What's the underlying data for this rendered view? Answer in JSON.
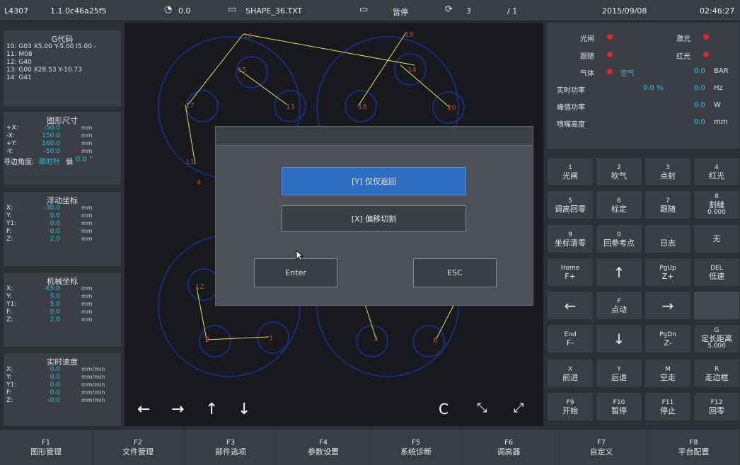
{
  "status": {
    "id": "L4307",
    "version": "1.1.0c46a25f5",
    "speed": "0.0",
    "file": "SHAPE_36.TXT",
    "state": "暂停",
    "count": "3",
    "page": "/ 1",
    "date": "2015/09/08",
    "time": "02:46:27"
  },
  "gcode": {
    "title": "G代码",
    "lines": [
      "10: G03 X5.00 Y-5.00 I5.00 -",
      "11: M08",
      "12: G40",
      "13: G00 X28.53 Y-10.73",
      "14: G41"
    ]
  },
  "size": {
    "title": "图形尺寸",
    "rows": [
      {
        "k": "+X:",
        "v": "-50.0",
        "u": "mm"
      },
      {
        "k": "-X:",
        "v": "150.0",
        "u": "mm"
      },
      {
        "k": "+Y:",
        "v": "160.0",
        "u": "mm"
      },
      {
        "k": "-Y:",
        "v": "-50.0",
        "u": "mm"
      }
    ],
    "edge_label": "寻边角度:",
    "edge_dir": "顺时针",
    "edge_off": "偏",
    "edge_val": "0.0 °"
  },
  "float": {
    "title": "浮动坐标",
    "rows": [
      {
        "k": "X:",
        "v": "-30.0",
        "u": "mm"
      },
      {
        "k": "Y:",
        "v": "0.0",
        "u": "mm"
      },
      {
        "k": "Y1:",
        "v": "0.0",
        "u": "mm"
      },
      {
        "k": "F:",
        "v": "0.0",
        "u": "mm"
      },
      {
        "k": "Z:",
        "v": "2.0",
        "u": "mm"
      }
    ]
  },
  "mech": {
    "title": "机械坐标",
    "rows": [
      {
        "k": "X:",
        "v": "-65.0",
        "u": "mm"
      },
      {
        "k": "Y:",
        "v": "5.0",
        "u": "mm"
      },
      {
        "k": "Y1:",
        "v": "5.0",
        "u": "mm"
      },
      {
        "k": "F:",
        "v": "0.0",
        "u": "mm"
      },
      {
        "k": "Z:",
        "v": "2.0",
        "u": "mm"
      }
    ]
  },
  "speedp": {
    "title": "实时速度",
    "rows": [
      {
        "k": "X:",
        "v": "0.0",
        "u": "mm/min"
      },
      {
        "k": "Y:",
        "v": "0.0",
        "u": "mm/min"
      },
      {
        "k": "Y1:",
        "v": "0.0",
        "u": "mm/min"
      },
      {
        "k": "F:",
        "v": "0.0",
        "u": "mm/min"
      },
      {
        "k": "Z:",
        "v": "-0.0",
        "u": "mm/min"
      }
    ]
  },
  "right": {
    "shutter": "光闸",
    "laser": "激光",
    "follow": "跟随",
    "red": "红光",
    "gas": "气体",
    "air": "空气",
    "gas_val": "0.0",
    "gas_unit": "BAR",
    "power": "实时功率",
    "power_val": "0.0 %",
    "power_hz": "0.0",
    "hz": "Hz",
    "peak": "峰值功率",
    "peak_val": "0.0",
    "w": "W",
    "nozzle": "喷嘴高度",
    "nozzle_val": "0.0",
    "mm": "mm"
  },
  "keys": [
    {
      "n": "1",
      "l": "光闸"
    },
    {
      "n": "2",
      "l": "吹气"
    },
    {
      "n": "3",
      "l": "点射"
    },
    {
      "n": "4",
      "l": "红光"
    },
    {
      "n": "5",
      "l": "调高回零"
    },
    {
      "n": "6",
      "l": "标定"
    },
    {
      "n": "7",
      "l": "跟随"
    },
    {
      "n": "8",
      "l": "割缝",
      "s": "0.000"
    },
    {
      "n": "9",
      "l": "坐标清零"
    },
    {
      "n": "0",
      "l": "回参考点"
    },
    {
      "n": ".",
      "l": "日志"
    },
    {
      "n": "",
      "l": "无"
    },
    {
      "n": "Home",
      "l": "F+"
    },
    {
      "n": "",
      "l": "↑",
      "a": true
    },
    {
      "n": "PgUp",
      "l": "Z+"
    },
    {
      "n": "DEL",
      "l": "低速"
    },
    {
      "n": "",
      "l": "←",
      "a": true
    },
    {
      "n": "F",
      "l": "点动"
    },
    {
      "n": "",
      "l": "→",
      "a": true
    },
    {
      "n": "",
      "l": ""
    },
    {
      "n": "End",
      "l": "F-"
    },
    {
      "n": "",
      "l": "↓",
      "a": true
    },
    {
      "n": "PgDn",
      "l": "Z-"
    },
    {
      "n": "G",
      "l": "定长距离",
      "s": "5.000"
    },
    {
      "n": "X",
      "l": "前进"
    },
    {
      "n": "Y",
      "l": "后退"
    },
    {
      "n": "M",
      "l": "空走"
    },
    {
      "n": "R",
      "l": "走边框"
    },
    {
      "n": "F9",
      "l": "开始"
    },
    {
      "n": "F10",
      "l": "暂停"
    },
    {
      "n": "F11",
      "l": "停止"
    },
    {
      "n": "F12",
      "l": "回零"
    }
  ],
  "fkeys": [
    {
      "n": "F1",
      "l": "图形管理"
    },
    {
      "n": "F2",
      "l": "文件管理"
    },
    {
      "n": "F3",
      "l": "部件选项"
    },
    {
      "n": "F4",
      "l": "参数设置"
    },
    {
      "n": "F5",
      "l": "系统诊断"
    },
    {
      "n": "F6",
      "l": "调高器"
    },
    {
      "n": "F7",
      "l": "自定义"
    },
    {
      "n": "F8",
      "l": "平台配置"
    }
  ],
  "dialog": {
    "opt1": "[Y] 仅仅返回",
    "opt2": "[X] 偏移切割",
    "enter": "Enter",
    "esc": "ESC"
  },
  "nav": {
    "left": "←",
    "right": "→",
    "up": "↑",
    "down": "↓",
    "refresh": "C",
    "shrink": "⤡",
    "expand": "⤢"
  },
  "labels": [
    "16",
    "15",
    "17",
    "13",
    "18",
    "19",
    "14",
    "20",
    "11",
    "12",
    "2",
    "1",
    "3",
    "8",
    "4"
  ]
}
